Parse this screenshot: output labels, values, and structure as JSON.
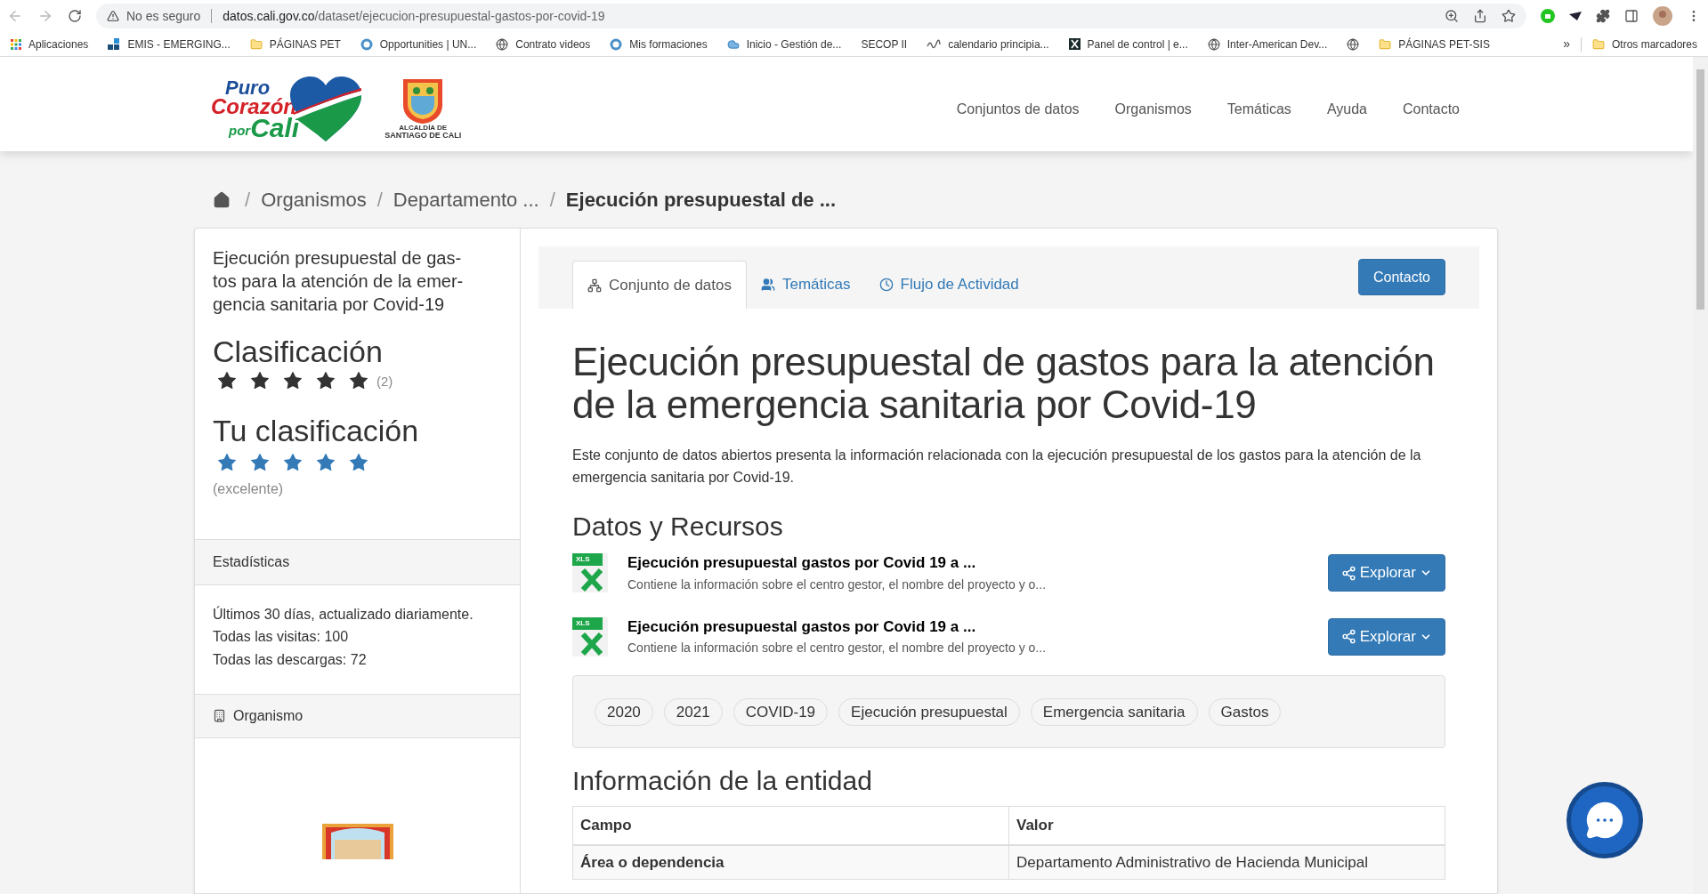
{
  "browser": {
    "security_label": "No es seguro",
    "url_host": "datos.cali.gov.co",
    "url_path": "/dataset/ejecucion-presupuestal-gastos-por-covid-19"
  },
  "bookmarks": [
    {
      "label": "Aplicaciones",
      "kind": "apps"
    },
    {
      "label": "EMIS - EMERGING...",
      "kind": "tiles"
    },
    {
      "label": "PÁGINAS PET",
      "kind": "folder"
    },
    {
      "label": "Opportunities | UN...",
      "kind": "badge"
    },
    {
      "label": "Contrato videos",
      "kind": "globe"
    },
    {
      "label": "Mis formaciones",
      "kind": "badge"
    },
    {
      "label": "Inicio - Gestión de...",
      "kind": "cloud"
    },
    {
      "label": "SECOP II",
      "kind": "plain"
    },
    {
      "label": "calendario principia...",
      "kind": "scribble"
    },
    {
      "label": "Panel de control | e...",
      "kind": "square"
    },
    {
      "label": "Inter-American Dev...",
      "kind": "globe"
    },
    {
      "kind": "globe"
    },
    {
      "label": "PÁGINAS PET-SIS",
      "kind": "folder"
    }
  ],
  "bookmarks_more": "»",
  "other_bookmarks": "Otros marcadores",
  "logo": {
    "lines": [
      "Puro",
      "Corazón",
      "por",
      "Cali"
    ],
    "seal_caption": [
      "ALCALDÍA DE",
      "SANTIAGO DE CALI"
    ]
  },
  "nav": [
    "Conjuntos de datos",
    "Organismos",
    "Temáticas",
    "Ayuda",
    "Contacto"
  ],
  "breadcrumb_separator": "/",
  "breadcrumb": [
    "Organismos",
    "Departamento ...",
    "Ejecución presupuestal de ..."
  ],
  "sidebar": {
    "title": "Ejecución presupuestal de gas-tos para la atención de la emer-gencia sanitaria por Covid-19",
    "rating": {
      "heading": "Clasificación",
      "stars": 5,
      "count": "(2)"
    },
    "your_rating": {
      "heading": "Tu clasificación",
      "stars": 5,
      "label": "(excelente)"
    },
    "stats": {
      "heading": "Estadísticas",
      "lines": [
        "Últimos 30 días, actualizado diariamente.",
        "Todas las visitas: 100",
        "Todas las descargas: 72"
      ]
    },
    "organism": {
      "heading": "Organismo"
    }
  },
  "tabs": [
    {
      "label": "Conjunto de datos",
      "selected": true
    },
    {
      "label": "Temáticas",
      "selected": false
    },
    {
      "label": "Flujo de Actividad",
      "selected": false
    }
  ],
  "contact_button": "Contacto",
  "dataset": {
    "title": "Ejecución presupuestal de gastos para la atención de la emergencia sanitaria por Covid-19",
    "description": "Este conjunto de datos abiertos presenta la información relacionada con la ejecución presupuestal de los gastos para la atención de la emergencia sanitaria por Covid-19.",
    "resources_heading": "Datos y Recursos",
    "resources": [
      {
        "format": "XLS",
        "title": "Ejecución presupuestal gastos por Covid 19 a ...",
        "description": "Contiene la información sobre el centro gestor, el nombre del proyecto y o...",
        "button": "Explorar"
      },
      {
        "format": "XLS",
        "title": "Ejecución presupuestal gastos por Covid 19 a ...",
        "description": "Contiene la información sobre el centro gestor, el nombre del proyecto y o...",
        "button": "Explorar"
      }
    ],
    "tags": [
      "2020",
      "2021",
      "COVID-19",
      "Ejecución presupuestal",
      "Emergencia sanitaria",
      "Gastos"
    ],
    "entity_heading": "Información de la entidad",
    "table": {
      "columns": [
        "Campo",
        "Valor"
      ],
      "rows": [
        [
          "Área o dependencia",
          "Departamento Administrativo de Hacienda Municipal"
        ]
      ]
    }
  }
}
